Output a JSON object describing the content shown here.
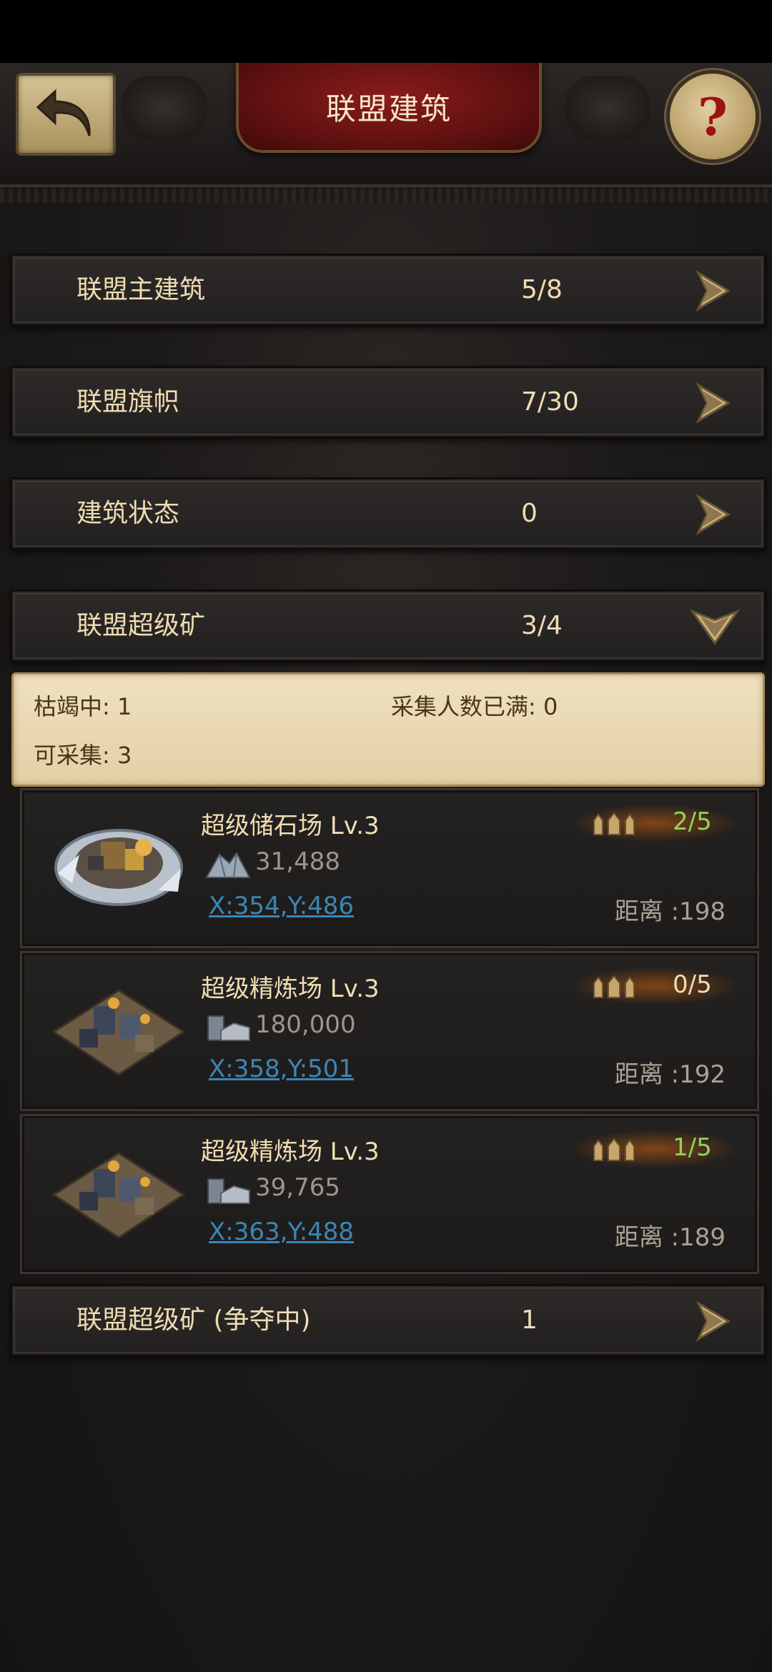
{
  "header": {
    "title": "联盟建筑"
  },
  "rows": [
    {
      "label": "联盟主建筑",
      "count": "5/8"
    },
    {
      "label": "联盟旗帜",
      "count": "7/30"
    },
    {
      "label": "建筑状态",
      "count": "0"
    },
    {
      "label": "联盟超级矿",
      "count": "3/4"
    },
    {
      "label": "联盟超级矿 (争夺中)",
      "count": "1"
    }
  ],
  "summary": {
    "depleting": "枯竭中: 1",
    "full": "采集人数已满: 0",
    "available": "可采集: 3"
  },
  "mines": [
    {
      "name": "超级储石场 Lv.3",
      "resource": "31,488",
      "coord": "X:354,Y:486",
      "distance": "距离 :198",
      "occupancy": "2/5",
      "occupancy_color": "#8fd45a",
      "resource_icon": "stone-icon"
    },
    {
      "name": "超级精炼场 Lv.3",
      "resource": "180,000",
      "coord": "X:358,Y:501",
      "distance": "距离 :192",
      "occupancy": "0/5",
      "occupancy_color": "#efdcb2",
      "resource_icon": "iron-icon"
    },
    {
      "name": "超级精炼场 Lv.3",
      "resource": "39,765",
      "coord": "X:363,Y:488",
      "distance": "距离 :189",
      "occupancy": "1/5",
      "occupancy_color": "#8fd45a",
      "resource_icon": "iron-icon"
    }
  ],
  "colors": {
    "accent_gold": "#efdcb2",
    "link_blue": "#3b86b4",
    "title_red": "#8a1d1b"
  }
}
